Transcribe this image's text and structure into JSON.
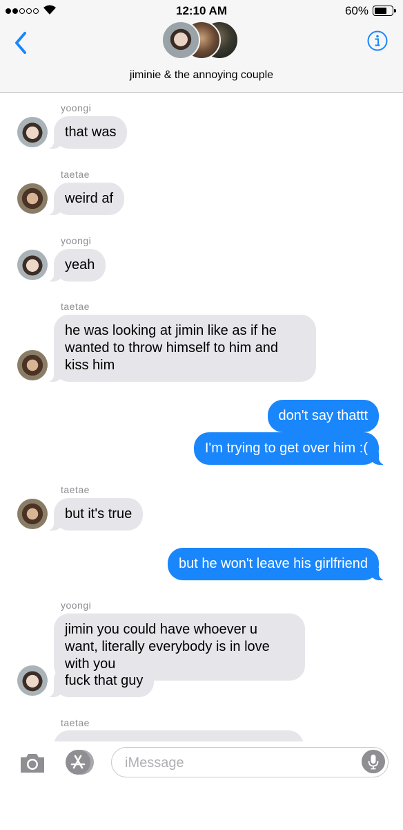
{
  "status_bar": {
    "time": "12:10 AM",
    "battery": "60%"
  },
  "header": {
    "title": "jiminie & the annoying couple"
  },
  "messages": [
    {
      "sender": "yoongi",
      "text": "that was"
    },
    {
      "sender": "taetae",
      "text": "weird af"
    },
    {
      "sender": "yoongi",
      "text": "yeah"
    },
    {
      "sender": "taetae",
      "text": "he was looking at jimin like as if he wanted to throw himself to him and kiss him"
    },
    {
      "sender": "me",
      "text": "don't say thattt"
    },
    {
      "sender": "me",
      "text": "I'm trying to get over him :("
    },
    {
      "sender": "taetae",
      "text": "but it's true"
    },
    {
      "sender": "me",
      "text": "but he won't leave his girlfriend"
    },
    {
      "sender": "yoongi",
      "text": "jimin you could have whoever u want, literally everybody is in love with you"
    },
    {
      "sender": "yoongi",
      "text": "fuck that guy"
    },
    {
      "sender": "taetae",
      "text": ""
    }
  ],
  "composer": {
    "placeholder": "iMessage"
  },
  "colors": {
    "accent": "#1a86fb",
    "incoming_bubble": "#e5e5ea"
  }
}
